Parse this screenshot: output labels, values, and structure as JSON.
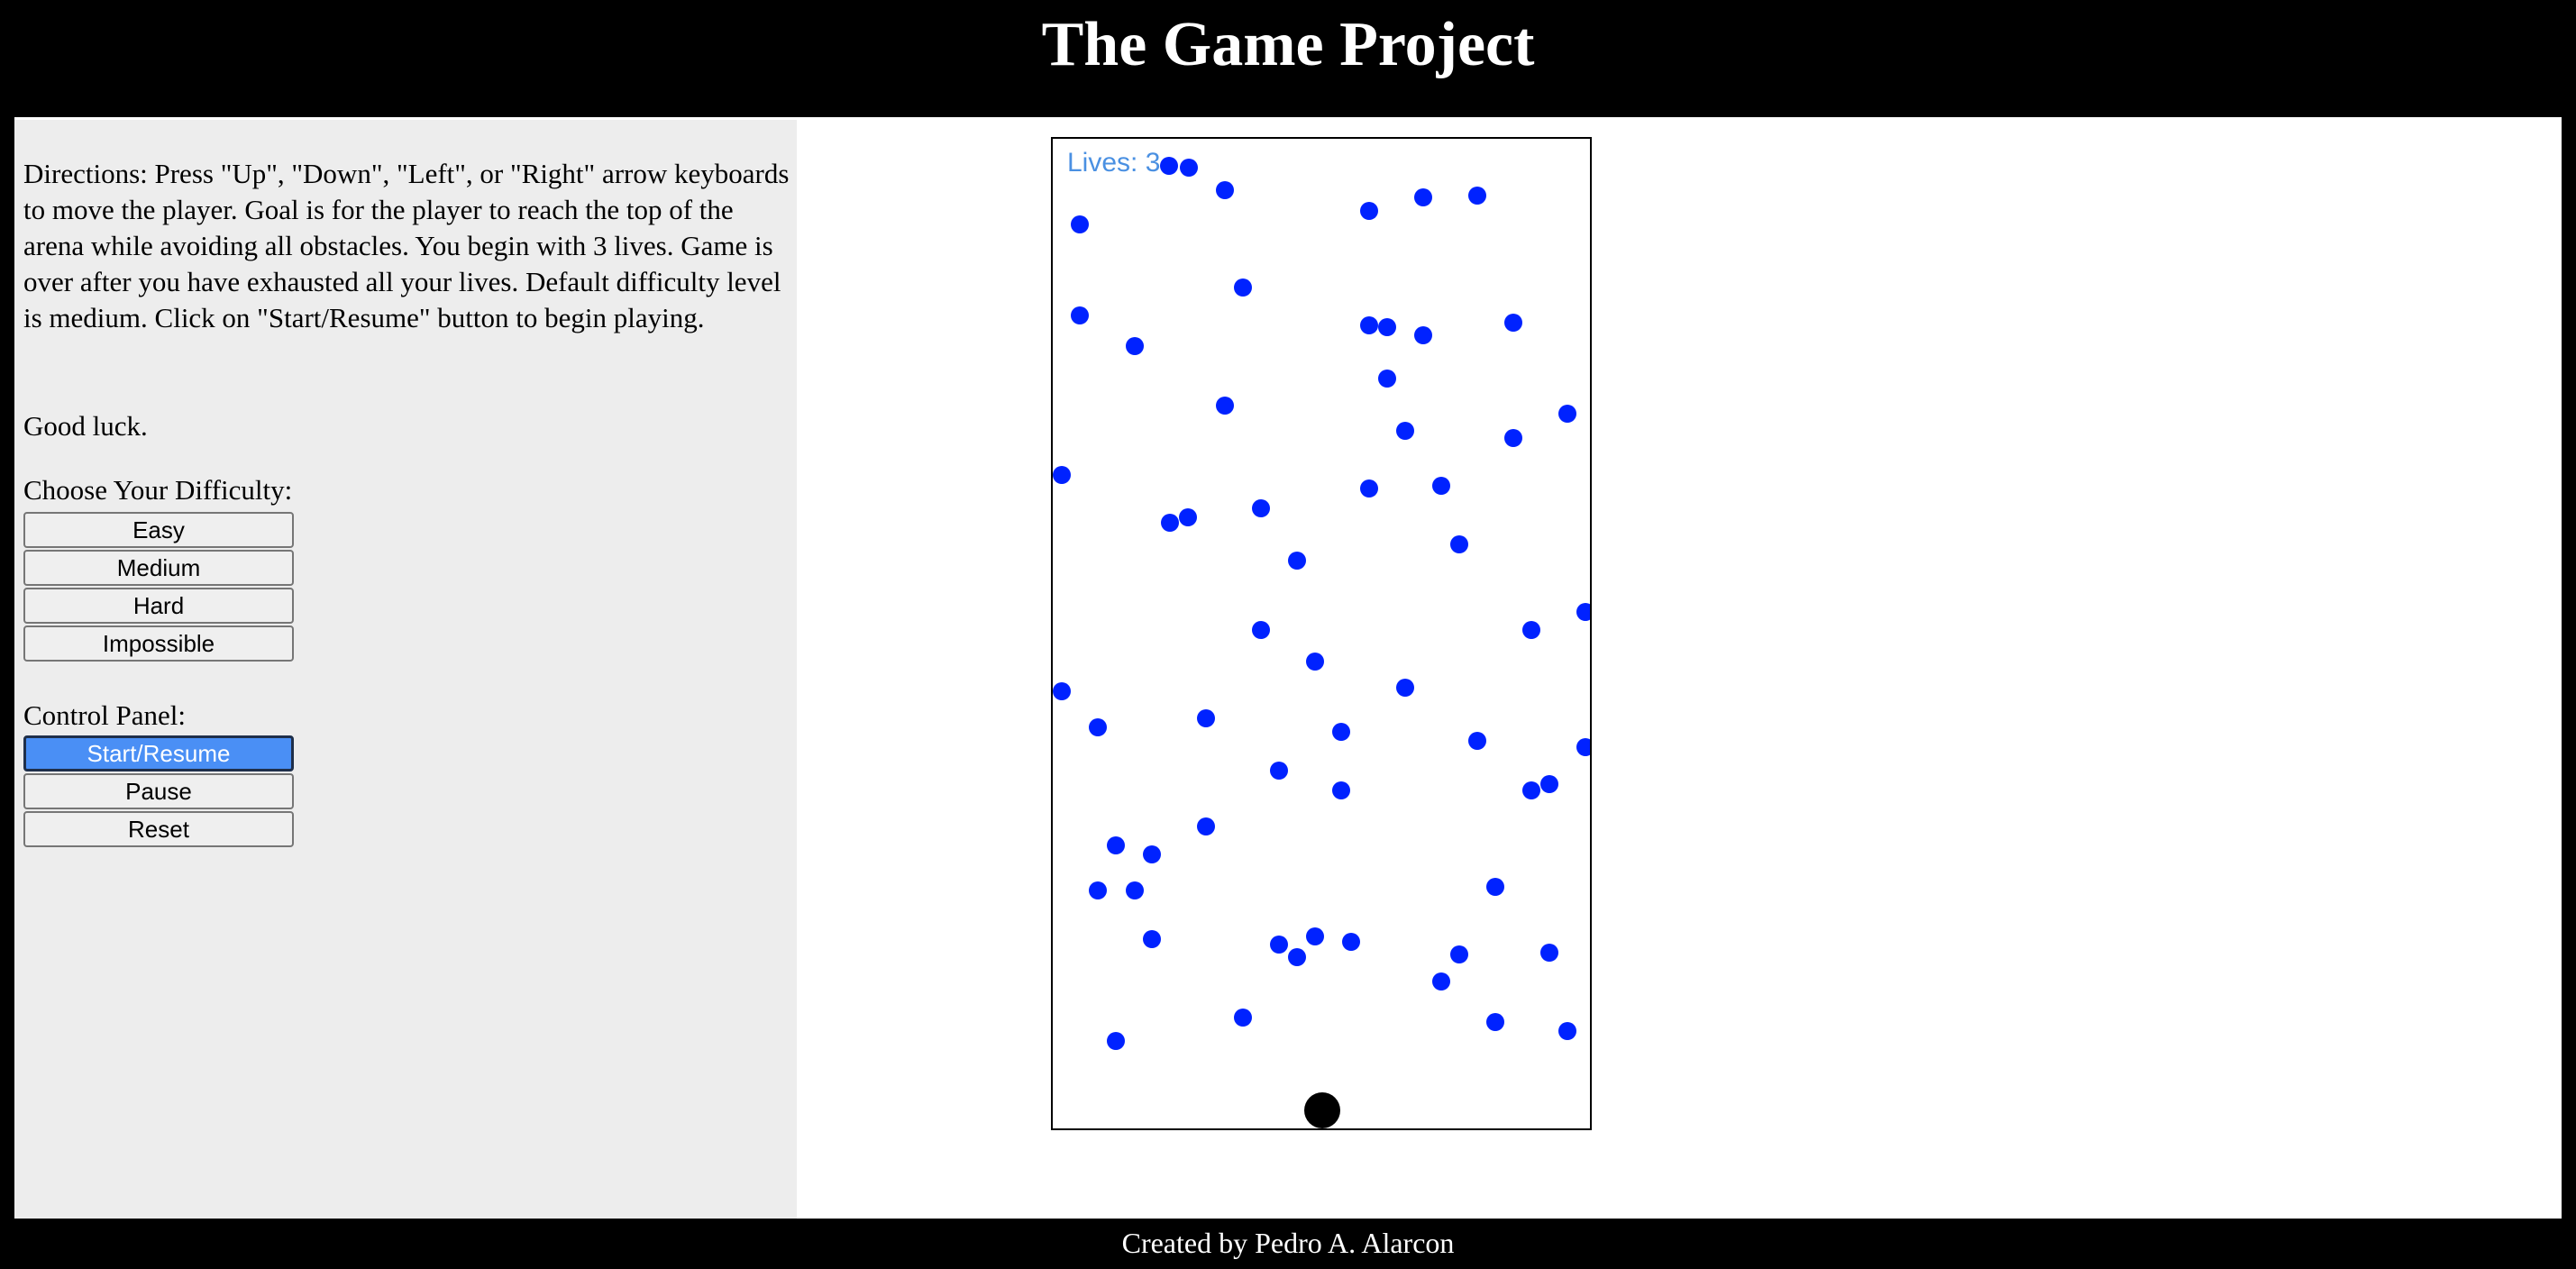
{
  "header": {
    "title": "The Game Project"
  },
  "sidebar": {
    "directions": "Directions: Press \"Up\", \"Down\", \"Left\", or \"Right\" arrow keyboards to move the player. Goal is for the player to reach the top of the arena while avoiding all obstacles. You begin with 3 lives. Game is over after you have exhausted all your lives. Default difficulty level is medium. Click on \"Start/Resume\" button to begin playing.",
    "good_luck": "Good luck.",
    "difficulty_label": "Choose Your Difficulty:",
    "difficulty_buttons": [
      "Easy",
      "Medium",
      "Hard",
      "Impossible"
    ],
    "control_label": "Control Panel:",
    "control_buttons": [
      "Start/Resume",
      "Pause",
      "Reset"
    ]
  },
  "game": {
    "lives_text": "Lives: 3",
    "obstacle_color": "#0022ff",
    "player_color": "#000000"
  },
  "footer": {
    "credit": "Created by Pedro A. Alarcon"
  }
}
